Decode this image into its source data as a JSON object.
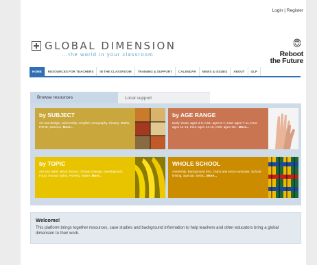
{
  "header": {
    "login_label": "Login",
    "separator": "|",
    "register_label": "Register",
    "logo_text": "GLOBAL DIMENSION",
    "logo_tagline": "...the world in your classroom",
    "partner_line1": "Reboot",
    "partner_line2": "the Future"
  },
  "nav": {
    "items": [
      "HOME",
      "RESOURCES FOR TEACHERS",
      "IN THE CLASSROOM",
      "TRAINING & SUPPORT",
      "CALENDAR",
      "NEWS & ISSUES",
      "ABOUT",
      "GLP"
    ],
    "active_index": 0
  },
  "tabs": {
    "browse_label": "Browse resources",
    "local_label": "Local support"
  },
  "cards": {
    "subject": {
      "title": "by SUBJECT",
      "description": "Art and design, Citizenship, English, Geography, History, Maths, PSHE, Science,",
      "more": "More..."
    },
    "age": {
      "title": "by AGE RANGE",
      "description": "Early Years: ages 3-5, KS1: ages 5-7, KS2: ages 7-11, KS3: ages 11-14, KS4: ages 14-16, KS5: ages 16+.",
      "more": "More..."
    },
    "topic": {
      "title": "by TOPIC",
      "description": "Aid and relief, Black history, Climate change, Development, Food, Human rights, Poverty, Water,",
      "more": "More..."
    },
    "whole": {
      "title": "WHOLE SCHOOL",
      "description": "Assembly, Background info, Clubs and extra-curricular, School linking, Special, SMSC,",
      "more": "More..."
    }
  },
  "welcome": {
    "title": "Welcome!",
    "text": "This platform brings together resources, case studies and background information to help teachers and other educators bring a global dimension to their work."
  },
  "colors": {
    "nav_accent": "#2f6fb3",
    "tagline": "#5aa0c8",
    "subject": "#c9a73d",
    "age": "#c97552",
    "topic": "#e8c400",
    "whole": "#cc8c00",
    "panel": "#cfdce8"
  }
}
